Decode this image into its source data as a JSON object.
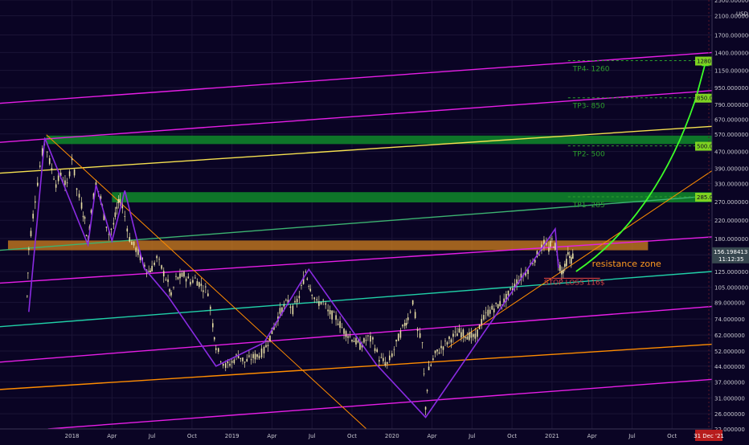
{
  "chart_data": {
    "type": "candlestick",
    "scale": "log",
    "currency": "USD",
    "grid": true,
    "colors": {
      "background": "#0a0424",
      "candle": "#e8dfa5",
      "axis_text": "#c8c8d0",
      "magenta": "#e61ee6",
      "yellow": "#f5e050",
      "green_line": "#3cb371",
      "teal": "#20d0a8",
      "orange": "#ff8c00",
      "purple": "#8a2be2",
      "zone_orange": "#d2801e",
      "zone_green": "#0f8a2a",
      "arrow_green": "#3cff28",
      "label_green": "#2ca02c",
      "price_box": "#7ed321",
      "current_price_bg": "#37474f",
      "date_box_bg": "#b71c1c"
    },
    "y_ticks": [
      "2500.000000",
      "2100.000000",
      "1700.000000",
      "1400.000000",
      "1150.000000",
      "950.000000",
      "790.000000",
      "670.000000",
      "570.000000",
      "470.000000",
      "390.000000",
      "330.000000",
      "270.000000",
      "220.000000",
      "180.000000",
      "150.000000",
      "125.000000",
      "105.000000",
      "89.000000",
      "74.000000",
      "62.000000",
      "52.000000",
      "44.000000",
      "37.000000",
      "31.000000",
      "26.000000",
      "22.000000"
    ],
    "y_ticks_num": [
      2500,
      2100,
      1700,
      1400,
      1150,
      950,
      790,
      670,
      570,
      470,
      390,
      330,
      270,
      220,
      180,
      150,
      125,
      105,
      89,
      74,
      62,
      52,
      44,
      37,
      31,
      26,
      22
    ],
    "x_ticks": [
      {
        "label": "2018",
        "t": 2018.0
      },
      {
        "label": "Apr",
        "t": 2018.25
      },
      {
        "label": "Jul",
        "t": 2018.5
      },
      {
        "label": "Oct",
        "t": 2018.75
      },
      {
        "label": "2019",
        "t": 2019.0
      },
      {
        "label": "Apr",
        "t": 2019.25
      },
      {
        "label": "Jul",
        "t": 2019.5
      },
      {
        "label": "Oct",
        "t": 2019.75
      },
      {
        "label": "2020",
        "t": 2020.0
      },
      {
        "label": "Apr",
        "t": 2020.25
      },
      {
        "label": "Jul",
        "t": 2020.5
      },
      {
        "label": "Oct",
        "t": 2020.75
      },
      {
        "label": "2021",
        "t": 2021.0
      },
      {
        "label": "Apr",
        "t": 2021.25
      },
      {
        "label": "Jul",
        "t": 2021.5
      },
      {
        "label": "Oct",
        "t": 2021.75
      }
    ],
    "x_range": [
      2017.55,
      2022.0
    ],
    "y_range": [
      22,
      2500
    ],
    "price_path": [
      [
        2017.72,
        95
      ],
      [
        2017.73,
        160
      ],
      [
        2017.77,
        280
      ],
      [
        2017.8,
        400
      ],
      [
        2017.83,
        540
      ],
      [
        2017.86,
        420
      ],
      [
        2017.9,
        330
      ],
      [
        2017.93,
        360
      ],
      [
        2017.97,
        320
      ],
      [
        2018.0,
        440
      ],
      [
        2018.03,
        310
      ],
      [
        2018.06,
        260
      ],
      [
        2018.08,
        220
      ],
      [
        2018.1,
        170
      ],
      [
        2018.12,
        250
      ],
      [
        2018.15,
        330
      ],
      [
        2018.18,
        280
      ],
      [
        2018.2,
        230
      ],
      [
        2018.23,
        190
      ],
      [
        2018.26,
        210
      ],
      [
        2018.28,
        250
      ],
      [
        2018.3,
        280
      ],
      [
        2018.33,
        230
      ],
      [
        2018.36,
        180
      ],
      [
        2018.4,
        160
      ],
      [
        2018.44,
        140
      ],
      [
        2018.48,
        125
      ],
      [
        2018.5,
        130
      ],
      [
        2018.53,
        145
      ],
      [
        2018.56,
        130
      ],
      [
        2018.6,
        110
      ],
      [
        2018.62,
        95
      ],
      [
        2018.65,
        115
      ],
      [
        2018.7,
        120
      ],
      [
        2018.74,
        112
      ],
      [
        2018.77,
        115
      ],
      [
        2018.82,
        105
      ],
      [
        2018.85,
        100
      ],
      [
        2018.88,
        70
      ],
      [
        2018.9,
        55
      ],
      [
        2018.93,
        48
      ],
      [
        2018.96,
        44
      ],
      [
        2019.0,
        46
      ],
      [
        2019.04,
        50
      ],
      [
        2019.08,
        46
      ],
      [
        2019.12,
        48
      ],
      [
        2019.17,
        50
      ],
      [
        2019.2,
        52
      ],
      [
        2019.25,
        64
      ],
      [
        2019.3,
        80
      ],
      [
        2019.35,
        90
      ],
      [
        2019.38,
        82
      ],
      [
        2019.42,
        95
      ],
      [
        2019.46,
        125
      ],
      [
        2019.48,
        110
      ],
      [
        2019.5,
        100
      ],
      [
        2019.53,
        88
      ],
      [
        2019.57,
        90
      ],
      [
        2019.6,
        80
      ],
      [
        2019.65,
        75
      ],
      [
        2019.7,
        65
      ],
      [
        2019.75,
        60
      ],
      [
        2019.8,
        55
      ],
      [
        2019.85,
        60
      ],
      [
        2019.88,
        58
      ],
      [
        2019.92,
        48
      ],
      [
        2019.97,
        45
      ],
      [
        2020.0,
        50
      ],
      [
        2020.04,
        60
      ],
      [
        2020.08,
        70
      ],
      [
        2020.1,
        75
      ],
      [
        2020.13,
        90
      ],
      [
        2020.16,
        65
      ],
      [
        2020.19,
        56
      ],
      [
        2020.21,
        28
      ],
      [
        2020.23,
        42
      ],
      [
        2020.27,
        50
      ],
      [
        2020.32,
        55
      ],
      [
        2020.37,
        60
      ],
      [
        2020.42,
        64
      ],
      [
        2020.47,
        62
      ],
      [
        2020.52,
        60
      ],
      [
        2020.56,
        72
      ],
      [
        2020.6,
        80
      ],
      [
        2020.65,
        85
      ],
      [
        2020.7,
        90
      ],
      [
        2020.74,
        100
      ],
      [
        2020.78,
        112
      ],
      [
        2020.82,
        120
      ],
      [
        2020.85,
        128
      ],
      [
        2020.88,
        140
      ],
      [
        2020.92,
        155
      ],
      [
        2020.95,
        170
      ],
      [
        2020.98,
        160
      ],
      [
        2021.0,
        175
      ],
      [
        2021.02,
        165
      ],
      [
        2021.04,
        140
      ],
      [
        2021.06,
        125
      ],
      [
        2021.08,
        130
      ],
      [
        2021.1,
        150
      ],
      [
        2021.12,
        142
      ],
      [
        2021.14,
        156
      ]
    ],
    "channel_lines": [
      {
        "color": "magenta",
        "t1": 2017.55,
        "v1": 800,
        "t2": 2022.0,
        "v2": 1400
      },
      {
        "color": "magenta",
        "t1": 2017.55,
        "v1": 520,
        "t2": 2022.0,
        "v2": 920
      },
      {
        "color": "yellow",
        "t1": 2017.55,
        "v1": 370,
        "t2": 2022.0,
        "v2": 620
      },
      {
        "color": "green_line",
        "t1": 2017.55,
        "v1": 158,
        "t2": 2022.0,
        "v2": 288
      },
      {
        "color": "magenta",
        "t1": 2017.55,
        "v1": 110,
        "t2": 2022.0,
        "v2": 183
      },
      {
        "color": "teal",
        "t1": 2017.55,
        "v1": 68,
        "t2": 2022.0,
        "v2": 125
      },
      {
        "color": "magenta",
        "t1": 2017.55,
        "v1": 46,
        "t2": 2022.0,
        "v2": 85
      },
      {
        "color": "orange",
        "t1": 2017.55,
        "v1": 34,
        "t2": 2022.0,
        "v2": 56
      },
      {
        "color": "magenta",
        "t1": 2017.85,
        "v1": 22,
        "t2": 2022.0,
        "v2": 38
      }
    ],
    "trend_lines": [
      {
        "color": "orange",
        "t1": 2017.84,
        "v1": 565,
        "t2": 2019.84,
        "v2": 22
      },
      {
        "color": "orange",
        "t1": 2020.35,
        "v1": 54,
        "t2": 2022.0,
        "v2": 380
      }
    ],
    "swing_path": [
      [
        2017.73,
        80
      ],
      [
        2017.83,
        545
      ],
      [
        2018.1,
        168
      ],
      [
        2018.15,
        325
      ],
      [
        2018.25,
        175
      ],
      [
        2018.33,
        305
      ],
      [
        2018.45,
        130
      ],
      [
        2018.6,
        95
      ],
      [
        2018.9,
        44
      ],
      [
        2019.2,
        57
      ],
      [
        2019.48,
        128
      ],
      [
        2019.9,
        45
      ],
      [
        2020.21,
        25
      ],
      [
        2021.02,
        200
      ],
      [
        2021.04,
        130
      ]
    ],
    "zones": [
      {
        "name": "resistance",
        "color": "zone_orange",
        "t1": 2017.6,
        "t2": 2021.6,
        "v1": 158,
        "v2": 176
      },
      {
        "name": "tp2",
        "color": "zone_green",
        "t1": 2017.84,
        "t2": 2022.0,
        "v1": 510,
        "v2": 560
      },
      {
        "name": "tp1",
        "color": "zone_green",
        "t1": 2018.25,
        "t2": 2022.0,
        "v1": 268,
        "v2": 300
      }
    ],
    "targets": [
      {
        "label": "TP4- 1260",
        "price": "1280.000000",
        "value": 1280
      },
      {
        "label": "TP3- 850",
        "price": "850.000000",
        "value": 850
      },
      {
        "label": "TP2- 500",
        "price": "500.000000",
        "value": 500
      },
      {
        "label": "TP1- 285",
        "price": "285.000000",
        "value": 285
      }
    ],
    "stop_loss": {
      "label": "STOP LOSS 116$",
      "value": 116,
      "t1": 2020.95,
      "t2": 2021.3
    },
    "annotation": "resistance zone",
    "current_price": "156.198413",
    "countdown": "11:12:35",
    "current_value": 156.2,
    "date_box": "31 Dec '21",
    "arrow_path": [
      [
        2021.15,
        125
      ],
      [
        2021.5,
        190
      ],
      [
        2021.75,
        380
      ],
      [
        2021.9,
        850
      ],
      [
        2021.96,
        1260
      ]
    ]
  }
}
